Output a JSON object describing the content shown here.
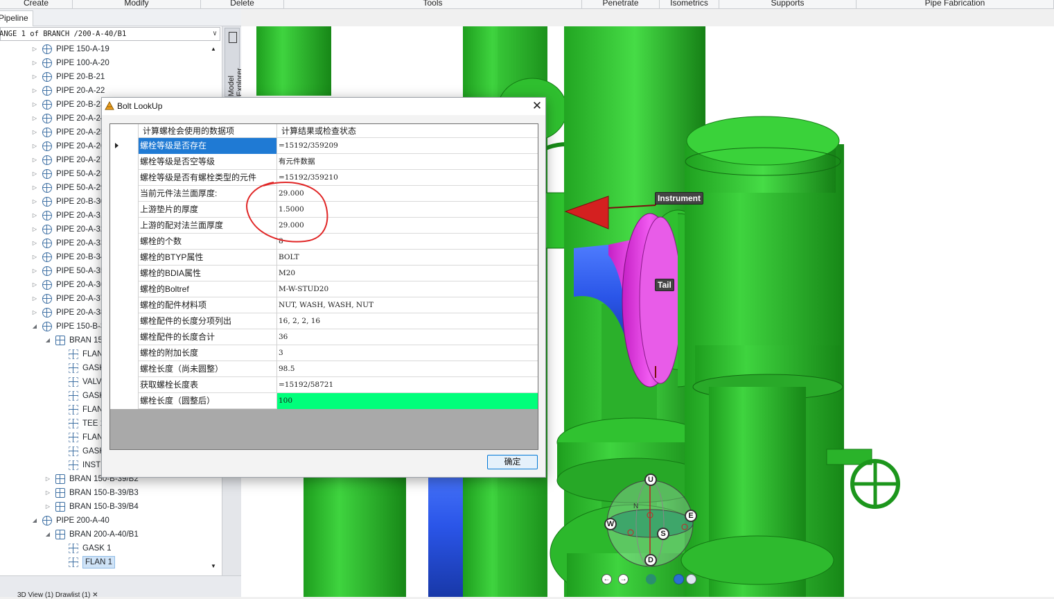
{
  "ribbon": {
    "groups": [
      "Create",
      "Modify",
      "Delete",
      "Tools",
      "Penetrate",
      "Isometrics",
      "Supports",
      "Pipe Fabrication"
    ]
  },
  "explorer": {
    "tab_label": "Pipeline",
    "combo_value": "ANGE 1 of BRANCH /200-A-40/B1",
    "side_tab_label": "Model Explorer",
    "tree": [
      {
        "label": "PIPE 150-A-19",
        "type": "pipe",
        "level": 0
      },
      {
        "label": "PIPE 100-A-20",
        "type": "pipe",
        "level": 0
      },
      {
        "label": "PIPE 20-B-21",
        "type": "pipe",
        "level": 0
      },
      {
        "label": "PIPE 20-A-22",
        "type": "pipe",
        "level": 0
      },
      {
        "label": "PIPE 20-B-23",
        "type": "pipe",
        "level": 0
      },
      {
        "label": "PIPE 20-A-24",
        "type": "pipe",
        "level": 0
      },
      {
        "label": "PIPE 20-A-25",
        "type": "pipe",
        "level": 0
      },
      {
        "label": "PIPE 20-A-26",
        "type": "pipe",
        "level": 0
      },
      {
        "label": "PIPE 20-A-27",
        "type": "pipe",
        "level": 0
      },
      {
        "label": "PIPE 50-A-28",
        "type": "pipe",
        "level": 0
      },
      {
        "label": "PIPE 50-A-29",
        "type": "pipe",
        "level": 0
      },
      {
        "label": "PIPE 20-B-30",
        "type": "pipe",
        "level": 0
      },
      {
        "label": "PIPE 20-A-31",
        "type": "pipe",
        "level": 0
      },
      {
        "label": "PIPE 20-A-32",
        "type": "pipe",
        "level": 0
      },
      {
        "label": "PIPE 20-A-33",
        "type": "pipe",
        "level": 0
      },
      {
        "label": "PIPE 20-B-34",
        "type": "pipe",
        "level": 0
      },
      {
        "label": "PIPE 50-A-35",
        "type": "pipe",
        "level": 0
      },
      {
        "label": "PIPE 20-A-36",
        "type": "pipe",
        "level": 0
      },
      {
        "label": "PIPE 20-A-37",
        "type": "pipe",
        "level": 0
      },
      {
        "label": "PIPE 20-A-38",
        "type": "pipe",
        "level": 0
      },
      {
        "label": "PIPE 150-B-39",
        "type": "pipe",
        "level": 0,
        "expanded": true
      },
      {
        "label": "BRAN 150-B-39/B1",
        "type": "bran",
        "level": 1,
        "expanded": true
      },
      {
        "label": "FLANGE 1",
        "type": "comp",
        "level": 2
      },
      {
        "label": "GASK 1",
        "type": "comp",
        "level": 2
      },
      {
        "label": "VALV 1",
        "type": "valv",
        "level": 2
      },
      {
        "label": "GASK 2",
        "type": "comp",
        "level": 2
      },
      {
        "label": "FLANGE 2",
        "type": "comp",
        "level": 2
      },
      {
        "label": "TEE 1",
        "type": "tee",
        "level": 2
      },
      {
        "label": "FLANGE 3",
        "type": "comp",
        "level": 2
      },
      {
        "label": "GASK 3",
        "type": "comp",
        "level": 2
      },
      {
        "label": "INST 1",
        "type": "inst",
        "level": 2
      },
      {
        "label": "BRAN 150-B-39/B2",
        "type": "bran",
        "level": 1
      },
      {
        "label": "BRAN 150-B-39/B3",
        "type": "bran",
        "level": 1
      },
      {
        "label": "BRAN 150-B-39/B4",
        "type": "bran",
        "level": 1
      },
      {
        "label": "PIPE 200-A-40",
        "type": "pipe",
        "level": 0,
        "expanded": true
      },
      {
        "label": "BRAN 200-A-40/B1",
        "type": "bran",
        "level": 1,
        "expanded": true
      },
      {
        "label": "GASK 1",
        "type": "comp",
        "level": 2
      },
      {
        "label": "FLAN 1",
        "type": "comp",
        "level": 2,
        "selected": true
      }
    ],
    "bottom_tabs": "3D View (1)   Drawlist (1)   ✕"
  },
  "viewport": {
    "tags": {
      "instrument": "Instrument",
      "tail": "Tail"
    },
    "compass": {
      "up": "U",
      "down": "D",
      "north": "N",
      "south": "S",
      "east": "E",
      "west": "W"
    },
    "colors": {
      "pipe_green": "#2fbf2f",
      "pipe_blue": "#2452e0",
      "flange_magenta": "#e63ee6",
      "arrow_red": "#d42020"
    }
  },
  "dialog": {
    "title": "Bolt LookUp",
    "columns": [
      "计算螺栓会使用的数据项",
      "计算结果或检查状态"
    ],
    "rows": [
      {
        "item": "螺栓等级是否存在",
        "value": "=15192/359209",
        "selected": true
      },
      {
        "item": "螺栓等级是否空等级",
        "value": "有元件数据"
      },
      {
        "item": "螺栓等级是否有螺栓类型的元件",
        "value": "=15192/359210"
      },
      {
        "item": "当前元件法兰面厚度:",
        "value": "29.000"
      },
      {
        "item": "上游垫片的厚度",
        "value": "1.5000"
      },
      {
        "item": "上游的配对法兰面厚度",
        "value": "29.000"
      },
      {
        "item": "螺栓的个数",
        "value": "8"
      },
      {
        "item": "螺栓的BTYP属性",
        "value": "BOLT"
      },
      {
        "item": "螺栓的BDIA属性",
        "value": "M20"
      },
      {
        "item": "螺栓的Boltref",
        "value": "M-W-STUD20"
      },
      {
        "item": "螺栓的配件材料项",
        "value": "NUT, WASH, WASH, NUT"
      },
      {
        "item": "螺栓配件的长度分项列出",
        "value": "16, 2, 2, 16"
      },
      {
        "item": "螺栓配件的长度合计",
        "value": "36"
      },
      {
        "item": "螺栓的附加长度",
        "value": "3"
      },
      {
        "item": "螺栓长度（尚未圆整）",
        "value": "98.5"
      },
      {
        "item": "获取螺栓长度表",
        "value": "=15192/58721"
      },
      {
        "item": "螺栓长度（圆整后）",
        "value": "100",
        "highlight": true
      }
    ],
    "ok_label": "确定",
    "highlight_color": "#00ff7b",
    "selection_color": "#1f7ad4"
  }
}
